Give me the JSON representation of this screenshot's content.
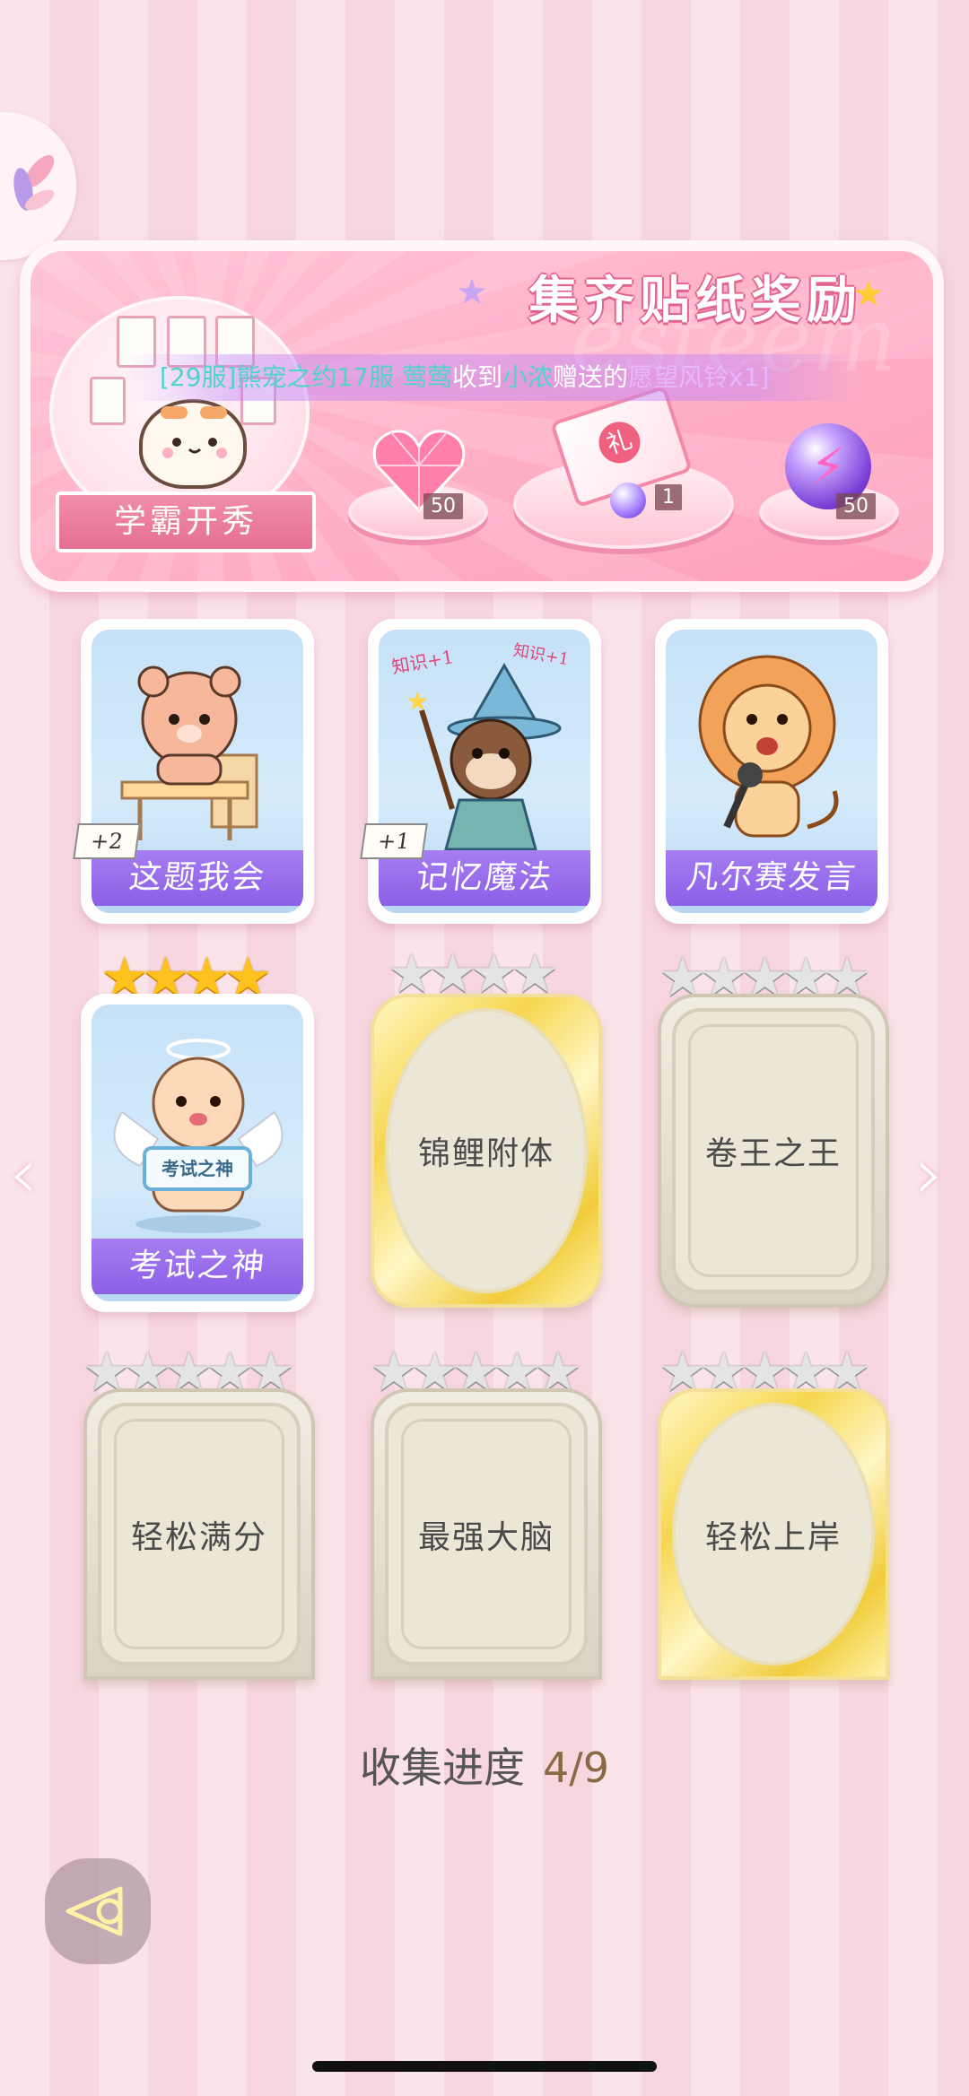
{
  "banner": {
    "title": "集齐贴纸奖励",
    "event_label": "学霸开秀",
    "marquee": {
      "server": "[29服]",
      "sender": "熊宠之约17服 莺莺",
      "received": "收到",
      "receiver": "小浓",
      "gifted": "赠送的",
      "item": "愿望风铃x1]"
    },
    "rewards": [
      {
        "icon": "pink-heart-gem-icon",
        "count": "50"
      },
      {
        "icon": "gift-box-icon",
        "count": "1"
      },
      {
        "icon": "purple-orb-icon",
        "count": "50"
      }
    ]
  },
  "cards": [
    {
      "title": "这题我会",
      "collected": true,
      "bonus": "+2"
    },
    {
      "title": "记忆魔法",
      "collected": true,
      "bonus": "+1"
    },
    {
      "title": "凡尔赛发言",
      "collected": true,
      "bonus": ""
    },
    {
      "title": "考试之神",
      "collected": true,
      "bonus": "",
      "stars": "★★★★",
      "sign": "考试之神"
    },
    {
      "title": "锦鲤附体",
      "collected": false,
      "stars": "★★★★"
    },
    {
      "title": "卷王之王",
      "collected": false,
      "stars": "★★★★★"
    },
    {
      "title": "轻松满分",
      "collected": false,
      "stars": "★★★★★"
    },
    {
      "title": "最强大脑",
      "collected": false,
      "stars": "★★★★★"
    },
    {
      "title": "轻松上岸",
      "collected": false,
      "stars": "★★★★★"
    }
  ],
  "card_marks": {
    "card1_text": "知识+1",
    "card1_text2": "知识+1"
  },
  "progress": {
    "label": "收集进度",
    "value": "4/9"
  },
  "nav": {
    "prev": "‹",
    "next": "›"
  },
  "colors": {
    "accent_purple": "#8c5fe6",
    "banner_pink": "#ff9fbc",
    "gold": "#f6d64f"
  }
}
